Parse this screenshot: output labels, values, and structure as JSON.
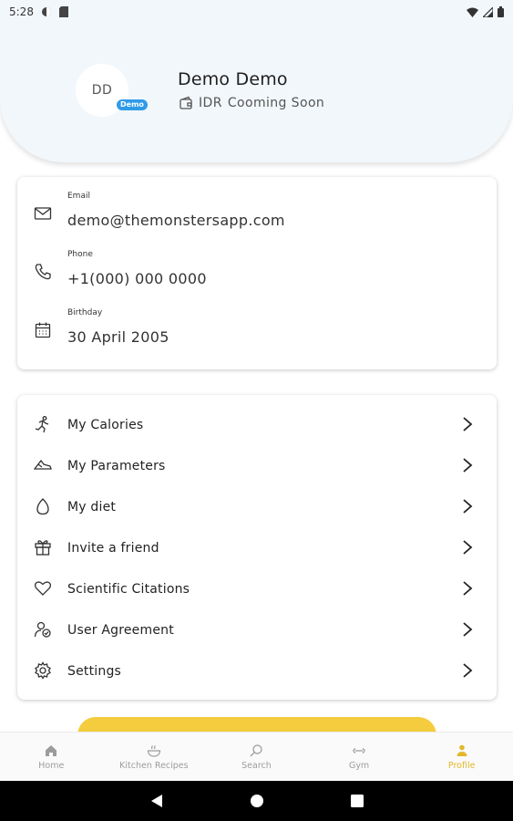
{
  "status_bar": {
    "time": "5:28"
  },
  "profile": {
    "initials": "DD",
    "badge": "Demo",
    "name": "Demo Demo",
    "currency": "IDR",
    "currency_status": "Cooming Soon"
  },
  "info": {
    "email": {
      "label": "Email",
      "value": "demo@themonstersapp.com",
      "icon": "mail-icon"
    },
    "phone": {
      "label": "Phone",
      "value": "+1(000) 000 0000",
      "icon": "phone-icon"
    },
    "birthday": {
      "label": "Birthday",
      "value": "30 April 2005",
      "icon": "calendar-icon"
    }
  },
  "menu": {
    "items": [
      {
        "label": "My Calories",
        "icon": "running-person-icon"
      },
      {
        "label": "My Parameters",
        "icon": "shoe-icon"
      },
      {
        "label": "My diet",
        "icon": "egg-icon"
      },
      {
        "label": "Invite a friend",
        "icon": "gift-icon"
      },
      {
        "label": "Scientific Citations",
        "icon": "heart-icon"
      },
      {
        "label": "User Agreement",
        "icon": "user-agreement-icon"
      },
      {
        "label": "Settings",
        "icon": "gear-icon"
      }
    ]
  },
  "tabs": [
    {
      "label": "Home",
      "icon": "home-icon",
      "active": false
    },
    {
      "label": "Kitchen Recipes",
      "icon": "bowl-icon",
      "active": false
    },
    {
      "label": "Search",
      "icon": "search-icon",
      "active": false
    },
    {
      "label": "Gym",
      "icon": "dumbbell-icon",
      "active": false
    },
    {
      "label": "Profile",
      "icon": "person-icon",
      "active": true
    }
  ],
  "colors": {
    "header_bg": "#f2f7fb",
    "badge": "#2f9be8",
    "accent": "#e3b72a",
    "logout_button": "#f4cc3d"
  }
}
